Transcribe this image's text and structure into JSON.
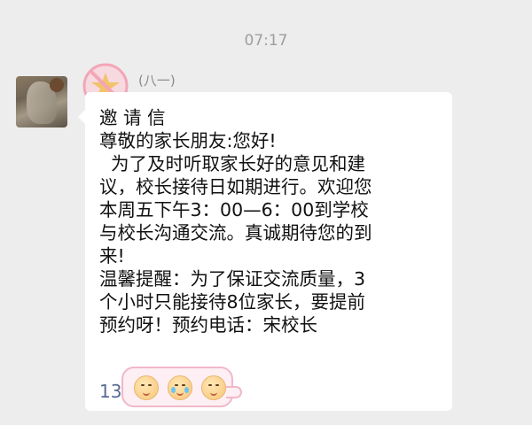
{
  "timestamp": "07:17",
  "message": {
    "sender_name": "(八一)",
    "lines": [
      "邀 请 信",
      "尊敬的家长朋友:您好!",
      "  为了及时听取家长好的意见和建",
      "议，校长接待日如期进行。欢迎您",
      "本周五下午3：00—6：00到学校",
      "与校长沟通交流。真诚期待您的到",
      "来!",
      "温馨提醒：为了保证交流质量，3",
      "个小时只能接待8位家长，要提前",
      "预约呀！预约电话：宋校长"
    ],
    "partial_phone": "13"
  },
  "icons": {
    "avatar": "profile-photo",
    "sticker": "no-star-sticker",
    "emojis": [
      "blush-face-icon",
      "crying-face-icon",
      "blush-face-icon"
    ]
  },
  "colors": {
    "background": "#ededed",
    "bubble": "#ffffff",
    "emoji_bar_border": "#f0b8c8",
    "emoji_bar_fill": "#fdeff3"
  }
}
